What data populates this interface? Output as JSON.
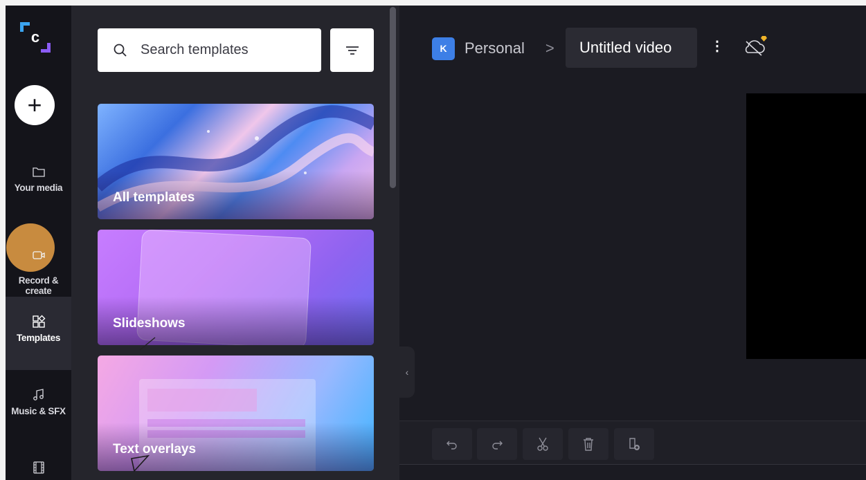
{
  "sidebar": {
    "create_label": "+",
    "items": [
      {
        "label": "Your media",
        "icon": "folder-icon"
      },
      {
        "label": "Record &\ncreate",
        "icon": "video-camera-icon"
      },
      {
        "label": "Templates",
        "icon": "templates-icon"
      },
      {
        "label": "Music & SFX",
        "icon": "music-note-icon"
      },
      {
        "label": "",
        "icon": "film-icon"
      }
    ],
    "active_item": "Templates"
  },
  "templates_panel": {
    "search_placeholder": "Search templates",
    "cards": [
      {
        "label": "All templates"
      },
      {
        "label": "Slideshows"
      },
      {
        "label": "Text overlays"
      }
    ]
  },
  "header": {
    "workspace_initial": "K",
    "workspace_name": "Personal",
    "separator": ">",
    "video_title": "Untitled video",
    "menu_glyph": "⋮"
  },
  "colors": {
    "accent_blue": "#3d7fe6",
    "highlight": "#e8a046",
    "logo_blue": "#3aa4f0",
    "logo_purple": "#8b5cf6"
  }
}
